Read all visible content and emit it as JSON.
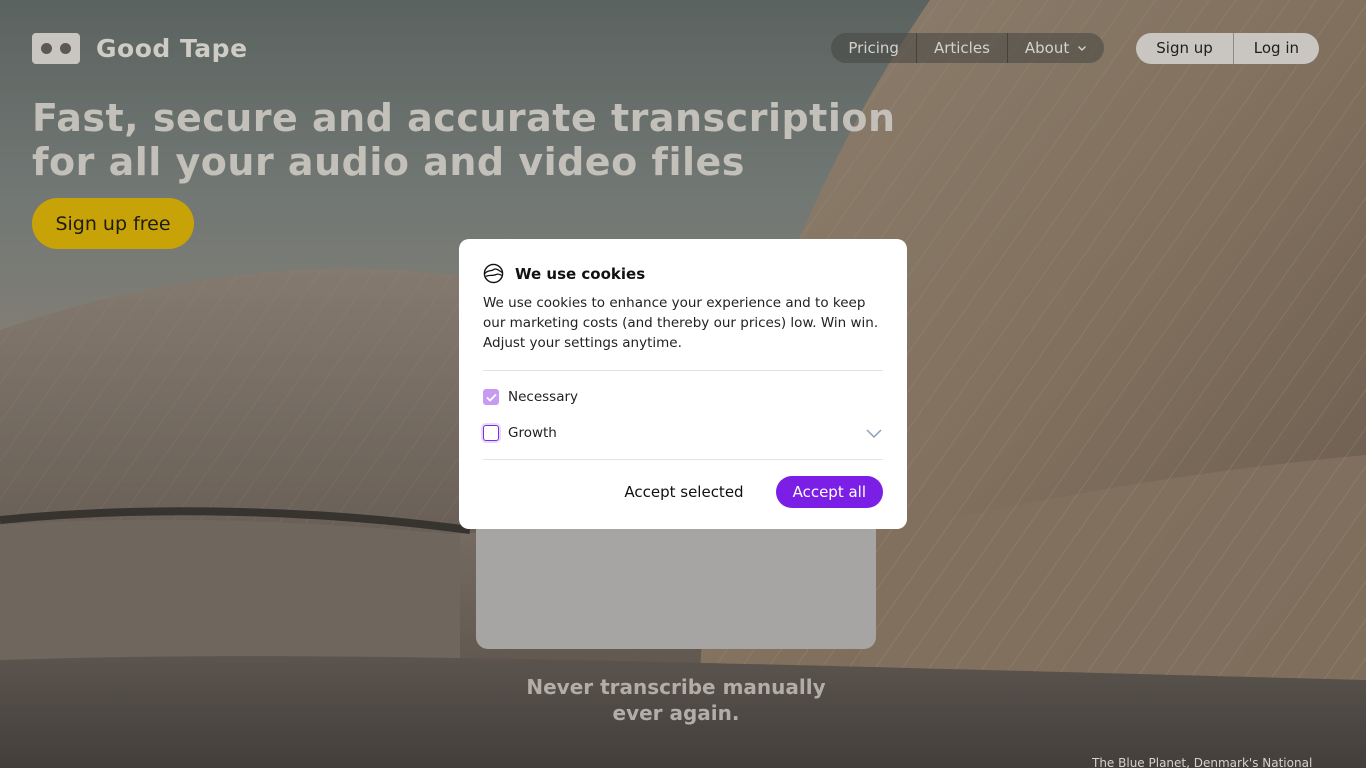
{
  "brand": {
    "name": "Good Tape"
  },
  "nav": {
    "items": [
      {
        "label": "Pricing"
      },
      {
        "label": "Articles"
      },
      {
        "label": "About"
      }
    ]
  },
  "auth": {
    "signup_label": "Sign up",
    "login_label": "Log in"
  },
  "hero": {
    "title_line1": "Fast, secure and accurate transcription",
    "title_line2": "for all your audio and video files",
    "cta_label": "Sign up free",
    "tagline_line1": "Never transcribe manually",
    "tagline_line2": "ever again."
  },
  "photo_caption": "The Blue Planet, Denmark's National",
  "cookie_modal": {
    "title": "We use cookies",
    "description": "We use cookies to enhance your experience and to keep our marketing costs (and thereby our prices) low. Win win. Adjust your settings anytime.",
    "options": [
      {
        "label": "Necessary",
        "checked": true
      },
      {
        "label": "Growth",
        "checked": false
      }
    ],
    "accept_selected_label": "Accept selected",
    "accept_all_label": "Accept all"
  },
  "colors": {
    "accent": "#7c1fe6",
    "cta": "#c8a308",
    "checkbox_checked": "#c79bf2"
  }
}
